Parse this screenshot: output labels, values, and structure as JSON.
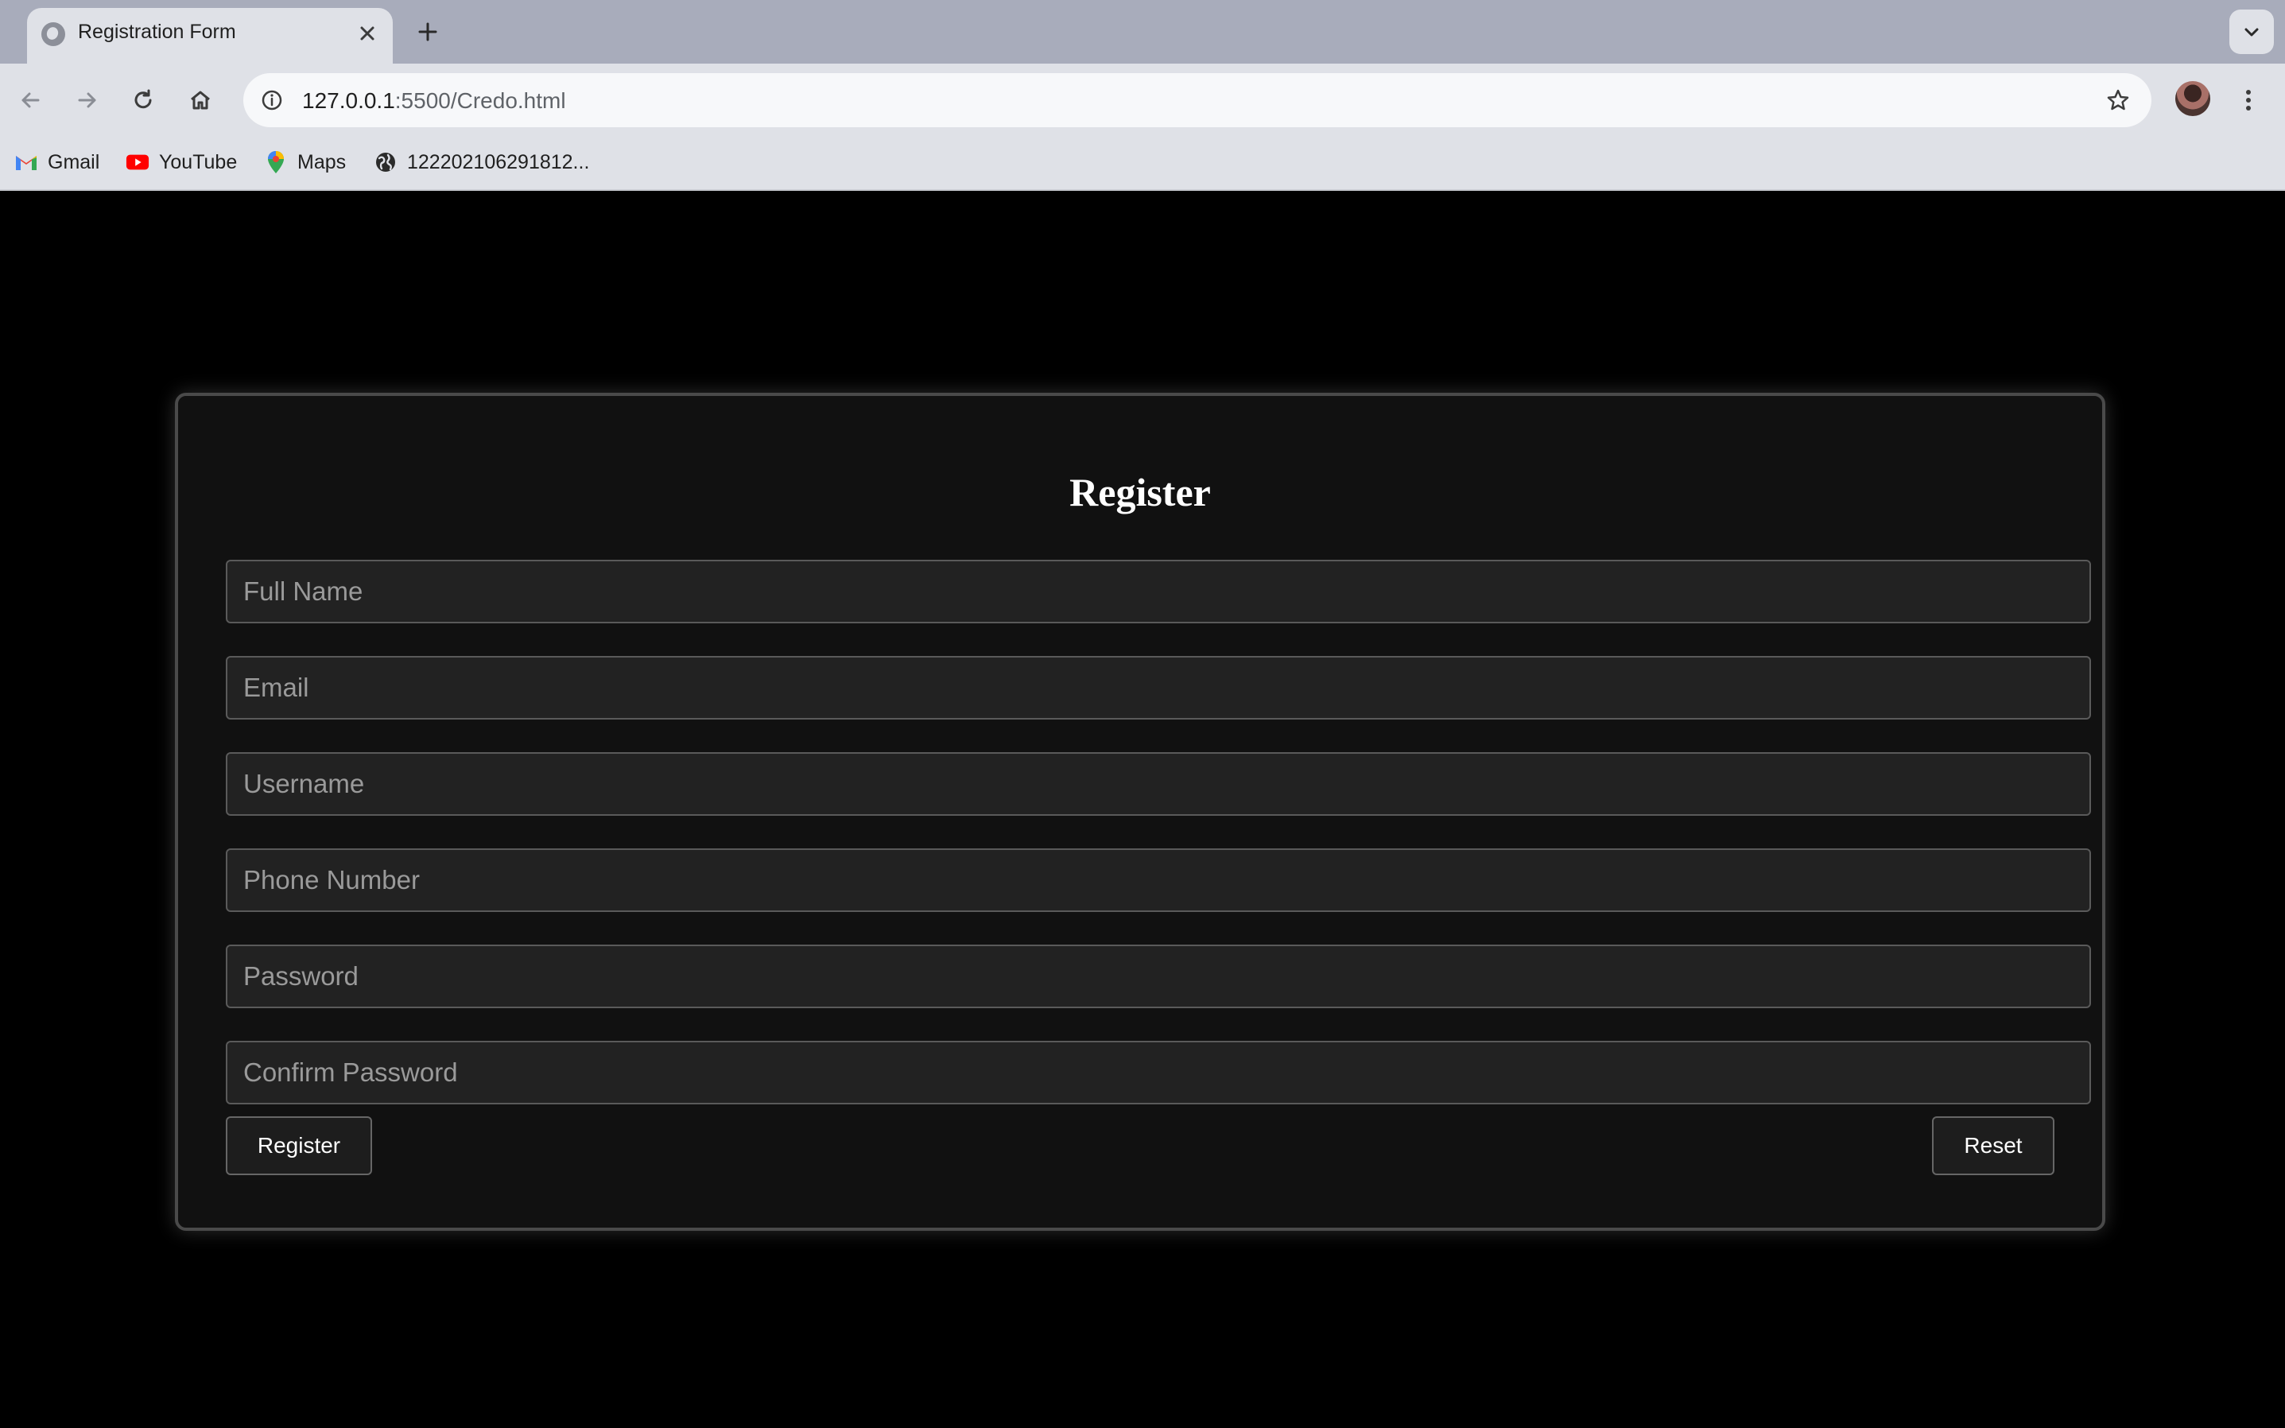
{
  "browser": {
    "tab": {
      "title": "Registration Form"
    },
    "url": {
      "host": "127.0.0.1",
      "rest": ":5500/Credo.html"
    },
    "bookmarks": [
      {
        "label": "Gmail",
        "icon": "gmail-icon"
      },
      {
        "label": "YouTube",
        "icon": "youtube-icon"
      },
      {
        "label": "Maps",
        "icon": "maps-icon"
      },
      {
        "label": "122202106291812...",
        "icon": "globe-icon"
      }
    ]
  },
  "form": {
    "title": "Register",
    "fields": {
      "full_name": {
        "placeholder": "Full Name",
        "value": ""
      },
      "email": {
        "placeholder": "Email",
        "value": ""
      },
      "username": {
        "placeholder": "Username",
        "value": ""
      },
      "phone": {
        "placeholder": "Phone Number",
        "value": ""
      },
      "password": {
        "placeholder": "Password",
        "value": ""
      },
      "confirm_password": {
        "placeholder": "Confirm Password",
        "value": ""
      }
    },
    "register_label": "Register",
    "reset_label": "Reset"
  },
  "colors": {
    "page_bg": "#000000",
    "card_bg": "#111111",
    "field_bg": "#222222",
    "chrome_bg": "#dfe1e7",
    "tabstrip_bg": "#a8acbb"
  }
}
